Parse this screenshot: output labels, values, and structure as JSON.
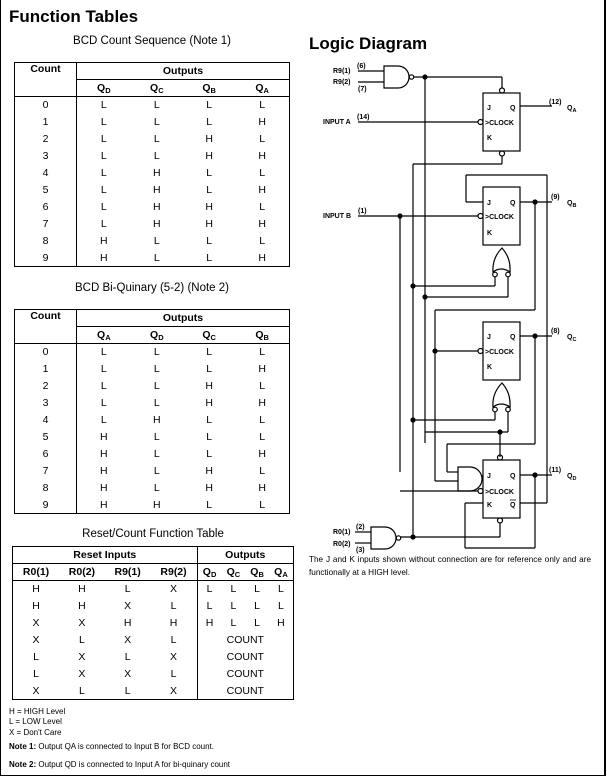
{
  "section_title": "Function Tables",
  "bcd_table": {
    "caption": "BCD Count Sequence (Note 1)",
    "count_header": "Count",
    "outputs_header": "Outputs",
    "columns": [
      {
        "base": "Q",
        "sub": "D"
      },
      {
        "base": "Q",
        "sub": "C"
      },
      {
        "base": "Q",
        "sub": "B"
      },
      {
        "base": "Q",
        "sub": "A"
      }
    ],
    "rows": [
      [
        "0",
        "L",
        "L",
        "L",
        "L"
      ],
      [
        "1",
        "L",
        "L",
        "L",
        "H"
      ],
      [
        "2",
        "L",
        "L",
        "H",
        "L"
      ],
      [
        "3",
        "L",
        "L",
        "H",
        "H"
      ],
      [
        "4",
        "L",
        "H",
        "L",
        "L"
      ],
      [
        "5",
        "L",
        "H",
        "L",
        "H"
      ],
      [
        "6",
        "L",
        "H",
        "H",
        "L"
      ],
      [
        "7",
        "L",
        "H",
        "H",
        "H"
      ],
      [
        "8",
        "H",
        "L",
        "L",
        "L"
      ],
      [
        "9",
        "H",
        "L",
        "L",
        "H"
      ]
    ]
  },
  "biquinary_table": {
    "caption": "BCD Bi-Quinary (5-2) (Note 2)",
    "count_header": "Count",
    "outputs_header": "Outputs",
    "columns": [
      {
        "base": "Q",
        "sub": "A"
      },
      {
        "base": "Q",
        "sub": "D"
      },
      {
        "base": "Q",
        "sub": "C"
      },
      {
        "base": "Q",
        "sub": "B"
      }
    ],
    "rows": [
      [
        "0",
        "L",
        "L",
        "L",
        "L"
      ],
      [
        "1",
        "L",
        "L",
        "L",
        "H"
      ],
      [
        "2",
        "L",
        "L",
        "H",
        "L"
      ],
      [
        "3",
        "L",
        "L",
        "H",
        "H"
      ],
      [
        "4",
        "L",
        "H",
        "L",
        "L"
      ],
      [
        "5",
        "H",
        "L",
        "L",
        "L"
      ],
      [
        "6",
        "H",
        "L",
        "L",
        "H"
      ],
      [
        "7",
        "H",
        "L",
        "H",
        "L"
      ],
      [
        "8",
        "H",
        "L",
        "H",
        "H"
      ],
      [
        "9",
        "H",
        "H",
        "L",
        "L"
      ]
    ]
  },
  "reset_table": {
    "caption": "Reset/Count Function Table",
    "reset_header": "Reset Inputs",
    "outputs_header": "Outputs",
    "input_columns": [
      "R0(1)",
      "R0(2)",
      "R9(1)",
      "R9(2)"
    ],
    "output_columns": [
      {
        "base": "Q",
        "sub": "D"
      },
      {
        "base": "Q",
        "sub": "C"
      },
      {
        "base": "Q",
        "sub": "B"
      },
      {
        "base": "Q",
        "sub": "A"
      }
    ],
    "rows": [
      {
        "inputs": [
          "H",
          "H",
          "L",
          "X"
        ],
        "outputs": [
          "L",
          "L",
          "L",
          "L"
        ]
      },
      {
        "inputs": [
          "H",
          "H",
          "X",
          "L"
        ],
        "outputs": [
          "L",
          "L",
          "L",
          "L"
        ]
      },
      {
        "inputs": [
          "X",
          "X",
          "H",
          "H"
        ],
        "outputs": [
          "H",
          "L",
          "L",
          "H"
        ]
      },
      {
        "inputs": [
          "X",
          "L",
          "X",
          "L"
        ],
        "outputs": "COUNT"
      },
      {
        "inputs": [
          "L",
          "X",
          "L",
          "X"
        ],
        "outputs": "COUNT"
      },
      {
        "inputs": [
          "L",
          "X",
          "X",
          "L"
        ],
        "outputs": "COUNT"
      },
      {
        "inputs": [
          "X",
          "L",
          "L",
          "X"
        ],
        "outputs": "COUNT"
      }
    ]
  },
  "legend": [
    "H = HIGH Level",
    "L = LOW Level",
    "X = Don't Care"
  ],
  "notes": [
    {
      "label": "Note 1:",
      "text": " Output QA is connected to Input B for BCD count."
    },
    {
      "label": "Note 2:",
      "text": " Output QD is connected to Input A for bi-quinary count"
    }
  ],
  "logic_diagram": {
    "title": "Logic Diagram",
    "labels": {
      "r91": "R9(1)",
      "r91_pin": "(6)",
      "r92": "R9(2)",
      "r92_pin": "(7)",
      "input_a": "INPUT A",
      "input_a_pin": "(14)",
      "input_b": "INPUT B",
      "input_b_pin": "(1)",
      "r01": "R0(1)",
      "r01_pin": "(2)",
      "r02": "R0(2)",
      "r02_pin": "(3)",
      "qa": "QA",
      "qa_pin": "(12)",
      "qb": "QB",
      "qb_pin": "(9)",
      "qc": "QC",
      "qc_pin": "(8)",
      "qd": "QD",
      "qd_pin": "(11)",
      "j": "J",
      "k": "K",
      "q": "Q",
      "qbar": "Q",
      "clock": "CLOCK"
    },
    "footnote": "The J and K inputs shown without connection are for reference only and are functionally at a HIGH level."
  }
}
